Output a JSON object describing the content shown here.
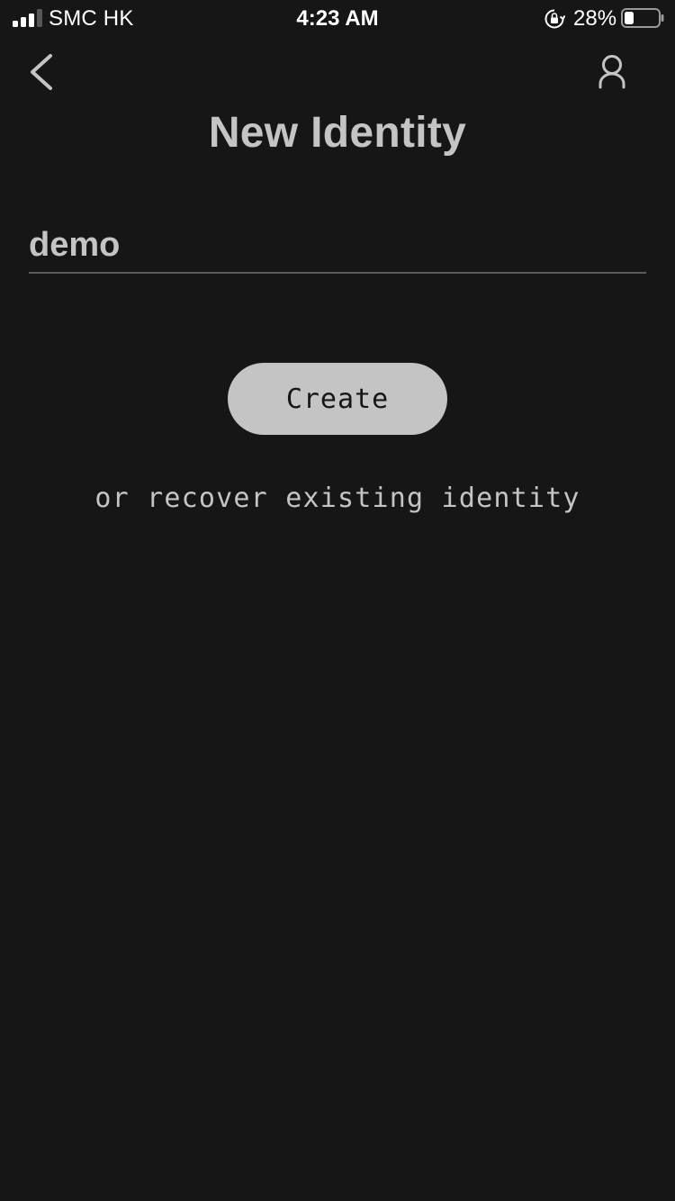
{
  "status_bar": {
    "carrier": "SMC HK",
    "time": "4:23 AM",
    "battery_percent_label": "28%",
    "battery_level": 0.28,
    "signal_bars_filled": 3,
    "signal_bars_total": 4
  },
  "nav": {
    "back_icon": "chevron-left-icon",
    "profile_icon": "person-icon"
  },
  "page": {
    "title": "New Identity"
  },
  "form": {
    "identity_name_value": "demo",
    "create_label": "Create",
    "recover_label": "or recover existing identity"
  },
  "colors": {
    "background": "#161616",
    "text": "#c4c4c4",
    "button_bg": "#c4c4c4",
    "button_text": "#161616",
    "divider": "#5c5c5c"
  }
}
